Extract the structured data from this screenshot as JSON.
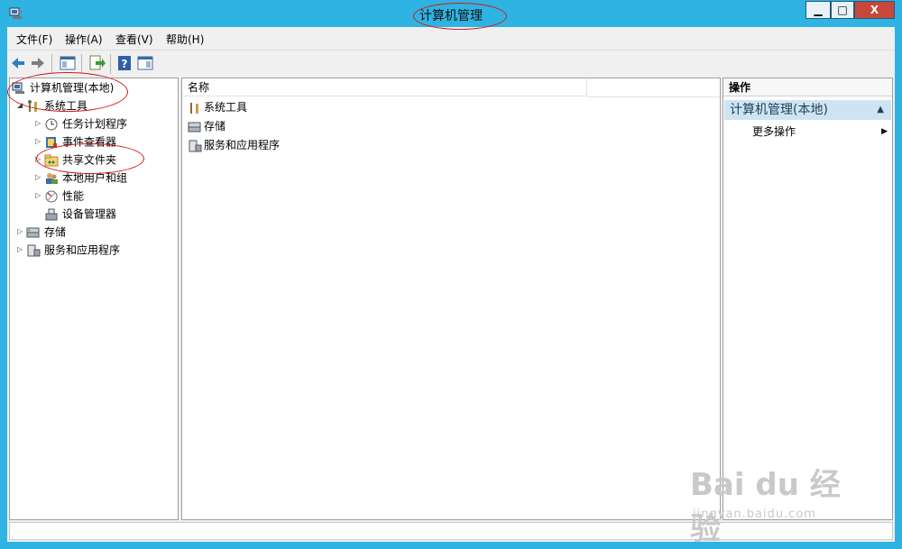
{
  "window": {
    "title": "计算机管理",
    "buttons": {
      "minimize": "▁",
      "maximize": "□",
      "close": "X"
    }
  },
  "menubar": {
    "items": [
      {
        "label": "文件(F)"
      },
      {
        "label": "操作(A)"
      },
      {
        "label": "查看(V)"
      },
      {
        "label": "帮助(H)"
      }
    ]
  },
  "toolbar": {
    "back_icon": "arrow-left-icon",
    "forward_icon": "arrow-right-icon",
    "help_label": "?"
  },
  "tree": {
    "root": "计算机管理(本地)",
    "system_tools": "系统工具",
    "task_scheduler": "任务计划程序",
    "event_viewer": "事件查看器",
    "shared_folders": "共享文件夹",
    "local_users": "本地用户和组",
    "performance": "性能",
    "device_manager": "设备管理器",
    "storage": "存储",
    "services_apps": "服务和应用程序"
  },
  "list": {
    "column_name": "名称",
    "rows": [
      "系统工具",
      "存储",
      "服务和应用程序"
    ]
  },
  "actions": {
    "title": "操作",
    "section": "计算机管理(本地)",
    "more": "更多操作"
  },
  "watermark": {
    "main": "Bai du 经验",
    "sub": "jingyan.baidu.com"
  },
  "colors": {
    "window_frame": "#2fb3e3",
    "close_button": "#c7473b",
    "annotation": "#d21a1a",
    "action_section_bg": "#cfe4f2"
  }
}
